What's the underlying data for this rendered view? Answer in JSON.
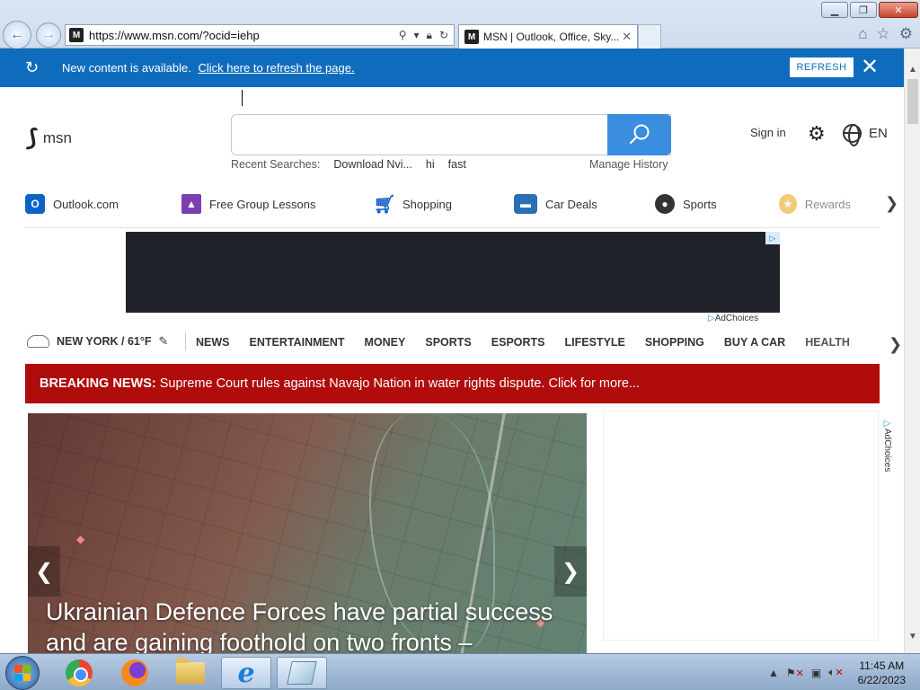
{
  "browser": {
    "url": "https://www.msn.com/?ocid=iehp",
    "tab_title": "MSN | Outlook, Office, Sky...",
    "favicon_letter": "M",
    "window_buttons": [
      "minimize",
      "restore",
      "close"
    ]
  },
  "refresh_bar": {
    "message": "New content is available.",
    "link": "Click here to refresh the page.",
    "button": "REFRESH",
    "close": "✕"
  },
  "header": {
    "logo": "msn",
    "search_placeholder": "",
    "recent_label": "Recent Searches:",
    "recent_items": [
      "Download Nvi...",
      "hi",
      "fast"
    ],
    "manage_history": "Manage History",
    "sign_in": "Sign in",
    "language": "EN"
  },
  "quick_links": [
    {
      "label": "Outlook.com",
      "icon": "outlook-icon",
      "color": "#0a64c8"
    },
    {
      "label": "Free Group Lessons",
      "icon": "graduation-cap-icon",
      "color": "#7b3fb2"
    },
    {
      "label": "Shopping",
      "icon": "cart-icon",
      "color": "#1a5fc8"
    },
    {
      "label": "Car Deals",
      "icon": "car-icon",
      "color": "#2b6fb8"
    },
    {
      "label": "Sports",
      "icon": "sports-ball-icon",
      "color": "#333333"
    },
    {
      "label": "Rewards",
      "icon": "trophy-icon",
      "color": "#e8a10f"
    }
  ],
  "ad": {
    "adchoices": "AdChoices"
  },
  "nav": {
    "weather": "NEW YORK / 61°F",
    "categories": [
      "NEWS",
      "ENTERTAINMENT",
      "MONEY",
      "SPORTS",
      "ESPORTS",
      "LIFESTYLE",
      "SHOPPING",
      "BUY A CAR",
      "HEALTH"
    ]
  },
  "breaking": {
    "label": "BREAKING NEWS:",
    "text": "Supreme Court rules against Navajo Nation in water rights dispute. Click for more..."
  },
  "hero": {
    "title": "Ukrainian Defence Forces have partial success and are gaining foothold on two fronts –"
  },
  "right_ad": {
    "adchoices": "AdChoices"
  },
  "taskbar": {
    "apps": [
      "start-button",
      "chrome",
      "firefox",
      "file-explorer",
      "internet-explorer",
      "notes"
    ],
    "time": "11:45 AM",
    "date": "6/22/2023"
  },
  "colors": {
    "refresh_bar": "#0f6cbd",
    "search_button": "#3a8ddf",
    "breaking_bg": "#b00c0c"
  }
}
